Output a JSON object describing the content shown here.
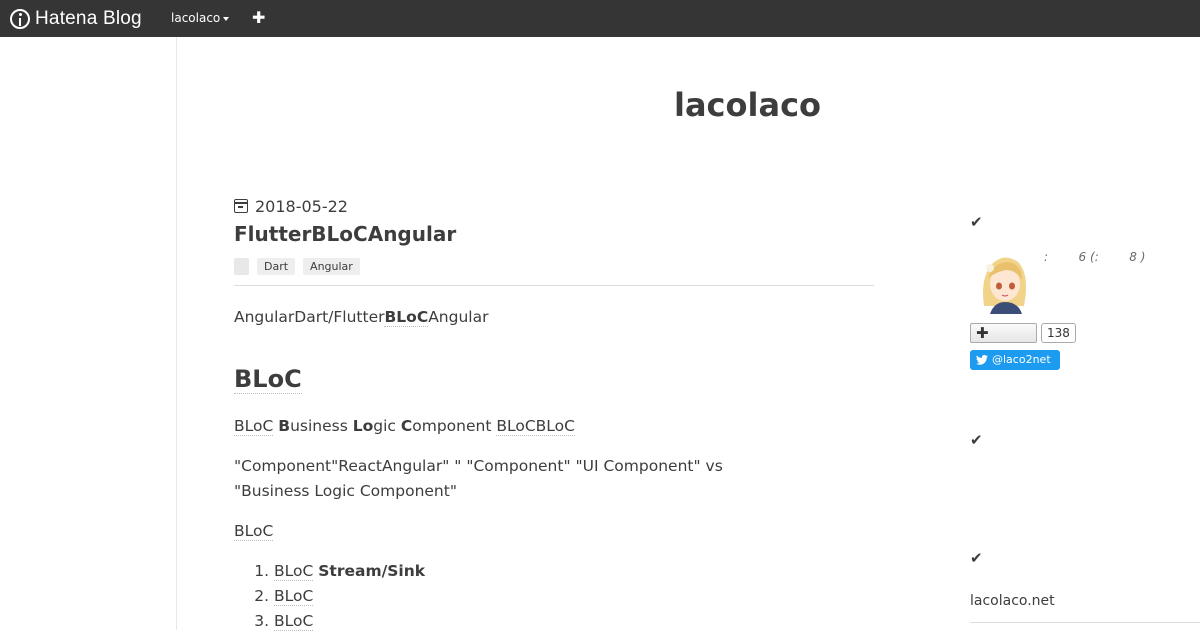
{
  "header": {
    "brand": "Hatena Blog",
    "user": "lacolaco",
    "add_label": "✚"
  },
  "blog": {
    "title": "lacolaco"
  },
  "entry": {
    "date": "2018-05-22",
    "title": "FlutterBLoCAngular",
    "tags": [
      "Dart",
      "Angular"
    ],
    "intro_prefix": "AngularDart/Flutter",
    "intro_bold": "BLoC",
    "intro_suffix": "Angular",
    "heading": "BLoC",
    "p2": {
      "a": "BLoC",
      "b1": "B",
      "b1_rest": "usiness ",
      "b2": "Lo",
      "b2_rest": "gic ",
      "b3": "C",
      "b3_rest": "omponent",
      "c": "BLoCBLoC"
    },
    "p3": "\"Component\"ReactAngular\"          \" \"Component\" \"UI Component\" vs \"Business Logic Component\"",
    "p4": "BLoC",
    "list": [
      {
        "num": "1.",
        "text": "BLoC",
        "bold": "Stream/Sink"
      },
      {
        "num": "2.",
        "text": "BLoC",
        "bold": ""
      },
      {
        "num": "3.",
        "text": "BLoC",
        "bold": ""
      }
    ]
  },
  "sidebar": {
    "check": "✔",
    "profile_meta": ":        6 (:        8 )",
    "follow_label": "✚",
    "follow_count": "138",
    "twitter_label": "@laco2net",
    "link": "lacolaco.net"
  },
  "colors": {
    "topbar": "#353535",
    "twitter": "#1d9bf0",
    "text": "#3d3d3d"
  }
}
